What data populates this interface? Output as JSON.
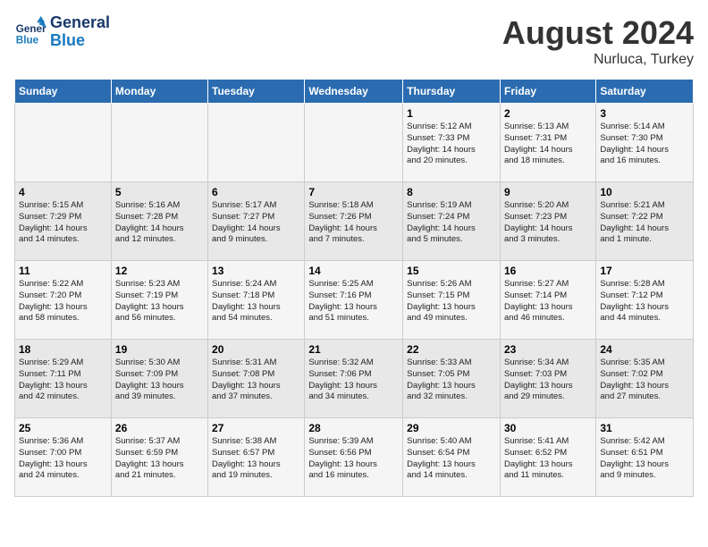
{
  "header": {
    "logo_line1": "General",
    "logo_line2": "Blue",
    "month": "August 2024",
    "location": "Nurluca, Turkey"
  },
  "days_of_week": [
    "Sunday",
    "Monday",
    "Tuesday",
    "Wednesday",
    "Thursday",
    "Friday",
    "Saturday"
  ],
  "weeks": [
    [
      {
        "day": "",
        "content": ""
      },
      {
        "day": "",
        "content": ""
      },
      {
        "day": "",
        "content": ""
      },
      {
        "day": "",
        "content": ""
      },
      {
        "day": "1",
        "content": "Sunrise: 5:12 AM\nSunset: 7:33 PM\nDaylight: 14 hours\nand 20 minutes."
      },
      {
        "day": "2",
        "content": "Sunrise: 5:13 AM\nSunset: 7:31 PM\nDaylight: 14 hours\nand 18 minutes."
      },
      {
        "day": "3",
        "content": "Sunrise: 5:14 AM\nSunset: 7:30 PM\nDaylight: 14 hours\nand 16 minutes."
      }
    ],
    [
      {
        "day": "4",
        "content": "Sunrise: 5:15 AM\nSunset: 7:29 PM\nDaylight: 14 hours\nand 14 minutes."
      },
      {
        "day": "5",
        "content": "Sunrise: 5:16 AM\nSunset: 7:28 PM\nDaylight: 14 hours\nand 12 minutes."
      },
      {
        "day": "6",
        "content": "Sunrise: 5:17 AM\nSunset: 7:27 PM\nDaylight: 14 hours\nand 9 minutes."
      },
      {
        "day": "7",
        "content": "Sunrise: 5:18 AM\nSunset: 7:26 PM\nDaylight: 14 hours\nand 7 minutes."
      },
      {
        "day": "8",
        "content": "Sunrise: 5:19 AM\nSunset: 7:24 PM\nDaylight: 14 hours\nand 5 minutes."
      },
      {
        "day": "9",
        "content": "Sunrise: 5:20 AM\nSunset: 7:23 PM\nDaylight: 14 hours\nand 3 minutes."
      },
      {
        "day": "10",
        "content": "Sunrise: 5:21 AM\nSunset: 7:22 PM\nDaylight: 14 hours\nand 1 minute."
      }
    ],
    [
      {
        "day": "11",
        "content": "Sunrise: 5:22 AM\nSunset: 7:20 PM\nDaylight: 13 hours\nand 58 minutes."
      },
      {
        "day": "12",
        "content": "Sunrise: 5:23 AM\nSunset: 7:19 PM\nDaylight: 13 hours\nand 56 minutes."
      },
      {
        "day": "13",
        "content": "Sunrise: 5:24 AM\nSunset: 7:18 PM\nDaylight: 13 hours\nand 54 minutes."
      },
      {
        "day": "14",
        "content": "Sunrise: 5:25 AM\nSunset: 7:16 PM\nDaylight: 13 hours\nand 51 minutes."
      },
      {
        "day": "15",
        "content": "Sunrise: 5:26 AM\nSunset: 7:15 PM\nDaylight: 13 hours\nand 49 minutes."
      },
      {
        "day": "16",
        "content": "Sunrise: 5:27 AM\nSunset: 7:14 PM\nDaylight: 13 hours\nand 46 minutes."
      },
      {
        "day": "17",
        "content": "Sunrise: 5:28 AM\nSunset: 7:12 PM\nDaylight: 13 hours\nand 44 minutes."
      }
    ],
    [
      {
        "day": "18",
        "content": "Sunrise: 5:29 AM\nSunset: 7:11 PM\nDaylight: 13 hours\nand 42 minutes."
      },
      {
        "day": "19",
        "content": "Sunrise: 5:30 AM\nSunset: 7:09 PM\nDaylight: 13 hours\nand 39 minutes."
      },
      {
        "day": "20",
        "content": "Sunrise: 5:31 AM\nSunset: 7:08 PM\nDaylight: 13 hours\nand 37 minutes."
      },
      {
        "day": "21",
        "content": "Sunrise: 5:32 AM\nSunset: 7:06 PM\nDaylight: 13 hours\nand 34 minutes."
      },
      {
        "day": "22",
        "content": "Sunrise: 5:33 AM\nSunset: 7:05 PM\nDaylight: 13 hours\nand 32 minutes."
      },
      {
        "day": "23",
        "content": "Sunrise: 5:34 AM\nSunset: 7:03 PM\nDaylight: 13 hours\nand 29 minutes."
      },
      {
        "day": "24",
        "content": "Sunrise: 5:35 AM\nSunset: 7:02 PM\nDaylight: 13 hours\nand 27 minutes."
      }
    ],
    [
      {
        "day": "25",
        "content": "Sunrise: 5:36 AM\nSunset: 7:00 PM\nDaylight: 13 hours\nand 24 minutes."
      },
      {
        "day": "26",
        "content": "Sunrise: 5:37 AM\nSunset: 6:59 PM\nDaylight: 13 hours\nand 21 minutes."
      },
      {
        "day": "27",
        "content": "Sunrise: 5:38 AM\nSunset: 6:57 PM\nDaylight: 13 hours\nand 19 minutes."
      },
      {
        "day": "28",
        "content": "Sunrise: 5:39 AM\nSunset: 6:56 PM\nDaylight: 13 hours\nand 16 minutes."
      },
      {
        "day": "29",
        "content": "Sunrise: 5:40 AM\nSunset: 6:54 PM\nDaylight: 13 hours\nand 14 minutes."
      },
      {
        "day": "30",
        "content": "Sunrise: 5:41 AM\nSunset: 6:52 PM\nDaylight: 13 hours\nand 11 minutes."
      },
      {
        "day": "31",
        "content": "Sunrise: 5:42 AM\nSunset: 6:51 PM\nDaylight: 13 hours\nand 9 minutes."
      }
    ]
  ]
}
